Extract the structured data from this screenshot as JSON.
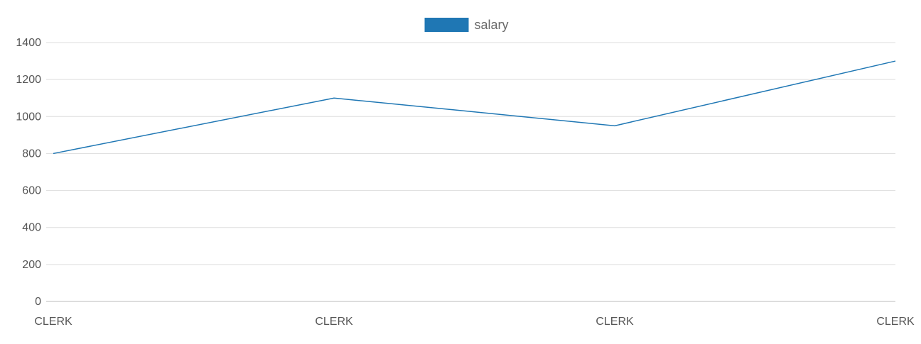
{
  "chart_data": {
    "type": "line",
    "categories": [
      "CLERK",
      "CLERK",
      "CLERK",
      "CLERK"
    ],
    "series": [
      {
        "name": "salary",
        "values": [
          800,
          1100,
          950,
          1300
        ],
        "color": "#1f77b4"
      }
    ],
    "yticks": [
      0,
      200,
      400,
      600,
      800,
      1000,
      1200,
      1400
    ],
    "ylim": [
      0,
      1400
    ],
    "grid": true,
    "legend_position": "top-center",
    "title": "",
    "xlabel": "",
    "ylabel": ""
  },
  "colors": {
    "grid": "#dddddd",
    "axis": "#bbbbbb",
    "tick_text": "#555555",
    "legend_text": "#666666"
  }
}
